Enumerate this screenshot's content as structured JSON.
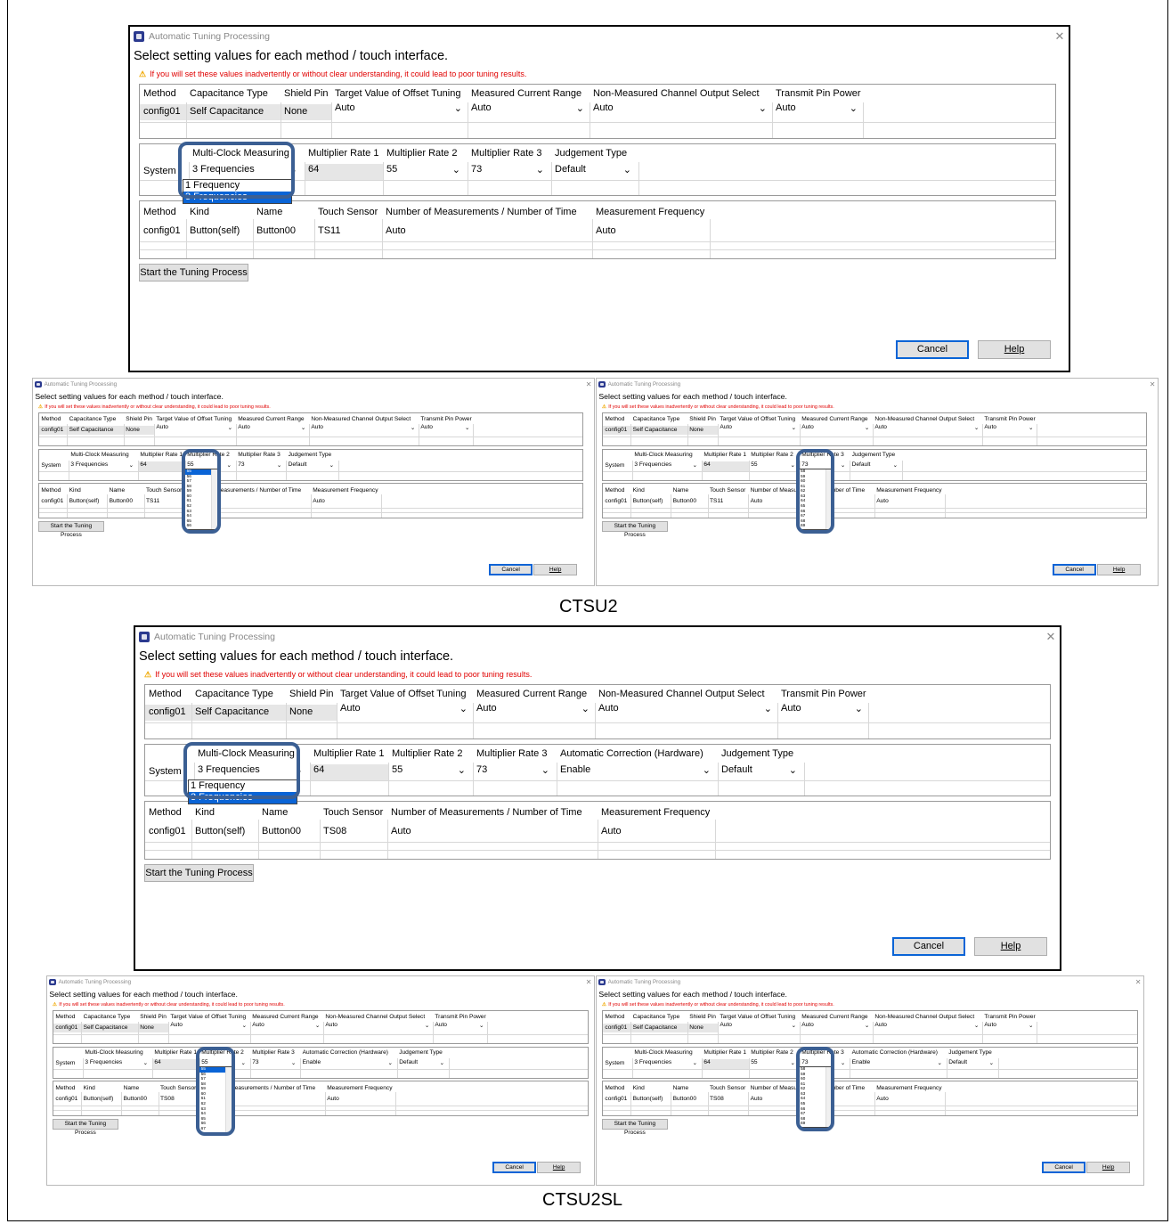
{
  "dialog": {
    "title": "Automatic Tuning Processing",
    "heading": "Select setting values for each method / touch interface.",
    "warning": "If you will set these values inadvertently or without clear understanding, it could lead to poor tuning results.",
    "method_headers": [
      "Method",
      "Capacitance Type",
      "Shield Pin",
      "Target Value of Offset Tuning",
      "Measured Current Range",
      "Non-Measured Channel Output Select",
      "Transmit Pin Power"
    ],
    "method_row": {
      "method": "config01",
      "cap_type": "Self Capacitance",
      "shield": "None",
      "offset": "Auto",
      "current_range": "Auto",
      "nonmeasured": "Auto",
      "tx_power": "Auto"
    },
    "sys_headers_ctsu2": [
      "Multi-Clock Measuring",
      "Multiplier Rate 1",
      "Multiplier Rate 2",
      "Multiplier Rate 3",
      "Judgement Type"
    ],
    "sys_headers_ctsu2sl": [
      "Multi-Clock Measuring",
      "Multiplier Rate 1",
      "Multiplier Rate 2",
      "Multiplier Rate 3",
      "Automatic Correction (Hardware)",
      "Judgement Type"
    ],
    "sys_row": {
      "label": "System",
      "multiclock": "3 Frequencies",
      "rate1": "64",
      "rate2": "55",
      "rate3": "73",
      "auto_corr": "Enable",
      "judgement": "Default"
    },
    "sensor_headers": [
      "Method",
      "Kind",
      "Name",
      "Touch Sensor",
      "Number of Measurements / Number of Time",
      "Measurement Frequency"
    ],
    "sensor_row_ctsu2": {
      "method": "config01",
      "kind": "Button(self)",
      "name": "Button00",
      "sensor": "TS11",
      "count": "Auto",
      "freq": "Auto"
    },
    "sensor_row_ctsu2sl": {
      "method": "config01",
      "kind": "Button(self)",
      "name": "Button00",
      "sensor": "TS08",
      "count": "Auto",
      "freq": "Auto"
    },
    "start_button": "Start the Tuning Process",
    "cancel_button": "Cancel",
    "help_button": "Help",
    "multiclock_options": [
      "1 Frequency",
      "3 Frequencies"
    ],
    "rate2_options": [
      "55",
      "56",
      "57",
      "58",
      "59",
      "60",
      "61",
      "62",
      "63",
      "64",
      "65",
      "66"
    ],
    "rate2_options_sl": [
      "55",
      "56",
      "57",
      "58",
      "59",
      "60",
      "61",
      "62",
      "63",
      "64",
      "65",
      "66",
      "67"
    ],
    "rate3_options": [
      "58",
      "59",
      "60",
      "61",
      "62",
      "63",
      "64",
      "65",
      "66",
      "67",
      "68",
      "69"
    ]
  },
  "captions": {
    "ctsu2": "CTSU2",
    "ctsu2sl": "CTSU2SL"
  },
  "colors": {
    "highlight": "#3b5f93",
    "selection": "#0a64d6",
    "warning": "#e00000"
  }
}
